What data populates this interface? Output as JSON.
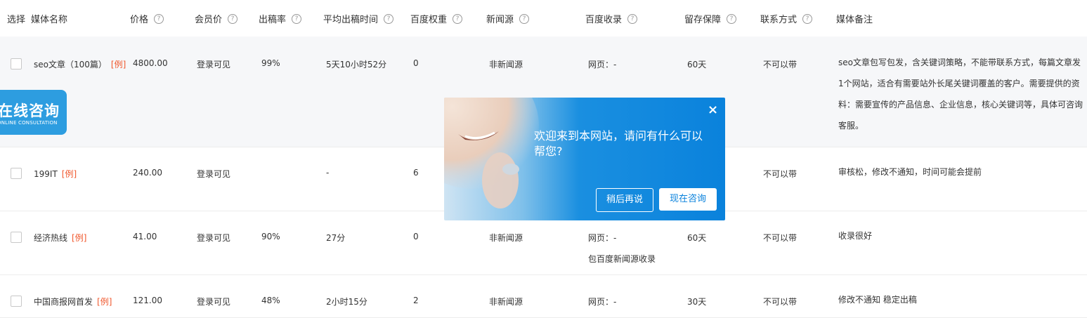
{
  "header": {
    "select": "选择",
    "media_name": "媒体名称",
    "price": "价格",
    "member_price": "会员价",
    "publish_rate": "出稿率",
    "avg_time": "平均出稿时间",
    "baidu_weight": "百度权重",
    "news_source": "新闻源",
    "baidu_index": "百度收录",
    "retention": "留存保障",
    "contact": "联系方式",
    "remarks": "媒体备注",
    "help_glyph": "?"
  },
  "example_tag": "[例]",
  "rows": [
    {
      "name": "seo文章（100篇）",
      "price": "4800.00",
      "member_price": "登录可见",
      "rate": "99%",
      "time": "5天10小时52分",
      "weight": "0",
      "news": "非新闻源",
      "index": "网页：-",
      "index2": "",
      "retention": "60天",
      "contact": "不可以带",
      "note": "seo文章包写包发，含关键词策略，不能带联系方式，每篇文章发1个网站，适合有需要站外长尾关键词覆盖的客户。需要提供的资料：需要宣传的产品信息、企业信息，核心关键词等，具体可咨询客服。"
    },
    {
      "name": "199IT",
      "price": "240.00",
      "member_price": "登录可见",
      "rate": "",
      "time": "-",
      "weight": "6",
      "news": "",
      "index": "",
      "index2": "",
      "retention": "",
      "contact": "不可以带",
      "note": "审核松，修改不通知，时间可能会提前"
    },
    {
      "name": "经济热线",
      "price": "41.00",
      "member_price": "登录可见",
      "rate": "90%",
      "time": "27分",
      "weight": "0",
      "news": "非新闻源",
      "index": "网页：-",
      "index2": "包百度新闻源收录",
      "retention": "60天",
      "contact": "不可以带",
      "note": "收录很好"
    },
    {
      "name": "中国商报网首发",
      "price": "121.00",
      "member_price": "登录可见",
      "rate": "48%",
      "time": "2小时15分",
      "weight": "2",
      "news": "非新闻源",
      "index": "网页：-",
      "index2": "",
      "retention": "30天",
      "contact": "不可以带",
      "note": "修改不通知 稳定出稿"
    }
  ],
  "consult_tab": {
    "title": "在线咨询",
    "subtitle": "ONLINE CONSULTATION"
  },
  "popup": {
    "message": "欢迎来到本网站，请问有什么可以帮您?",
    "close": "×",
    "later": "稍后再说",
    "consult_now": "现在咨询"
  },
  "colors": {
    "accent": "#0a82dc",
    "example": "#f0572c",
    "row_alt": "#f6f7f9"
  }
}
